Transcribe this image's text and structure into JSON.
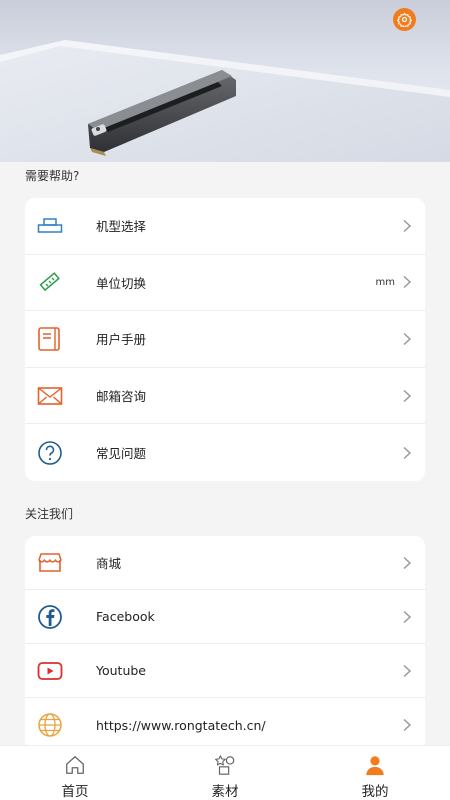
{
  "header": {
    "settings_icon": "gear-icon",
    "accent": "#f07c1e"
  },
  "help": {
    "title": "需要帮助?",
    "items": [
      {
        "label": "机型选择",
        "value": "",
        "icon": "printer-icon"
      },
      {
        "label": "单位切换",
        "value": "mm",
        "icon": "ruler-icon"
      },
      {
        "label": "用户手册",
        "value": "",
        "icon": "book-icon"
      },
      {
        "label": "邮箱咨询",
        "value": "",
        "icon": "mail-icon"
      },
      {
        "label": "常见问题",
        "value": "",
        "icon": "question-icon"
      }
    ]
  },
  "follow": {
    "title": "关注我们",
    "items": [
      {
        "label": "商城",
        "icon": "store-icon"
      },
      {
        "label": "Facebook",
        "icon": "facebook-icon"
      },
      {
        "label": "Youtube",
        "icon": "youtube-icon"
      },
      {
        "label": "https://www.rongtatech.cn/",
        "icon": "globe-icon"
      }
    ]
  },
  "tabbar": {
    "tabs": [
      {
        "label": "首页",
        "icon": "home-icon"
      },
      {
        "label": "素材",
        "icon": "materials-icon"
      },
      {
        "label": "我的",
        "icon": "profile-icon",
        "active": true
      }
    ]
  }
}
